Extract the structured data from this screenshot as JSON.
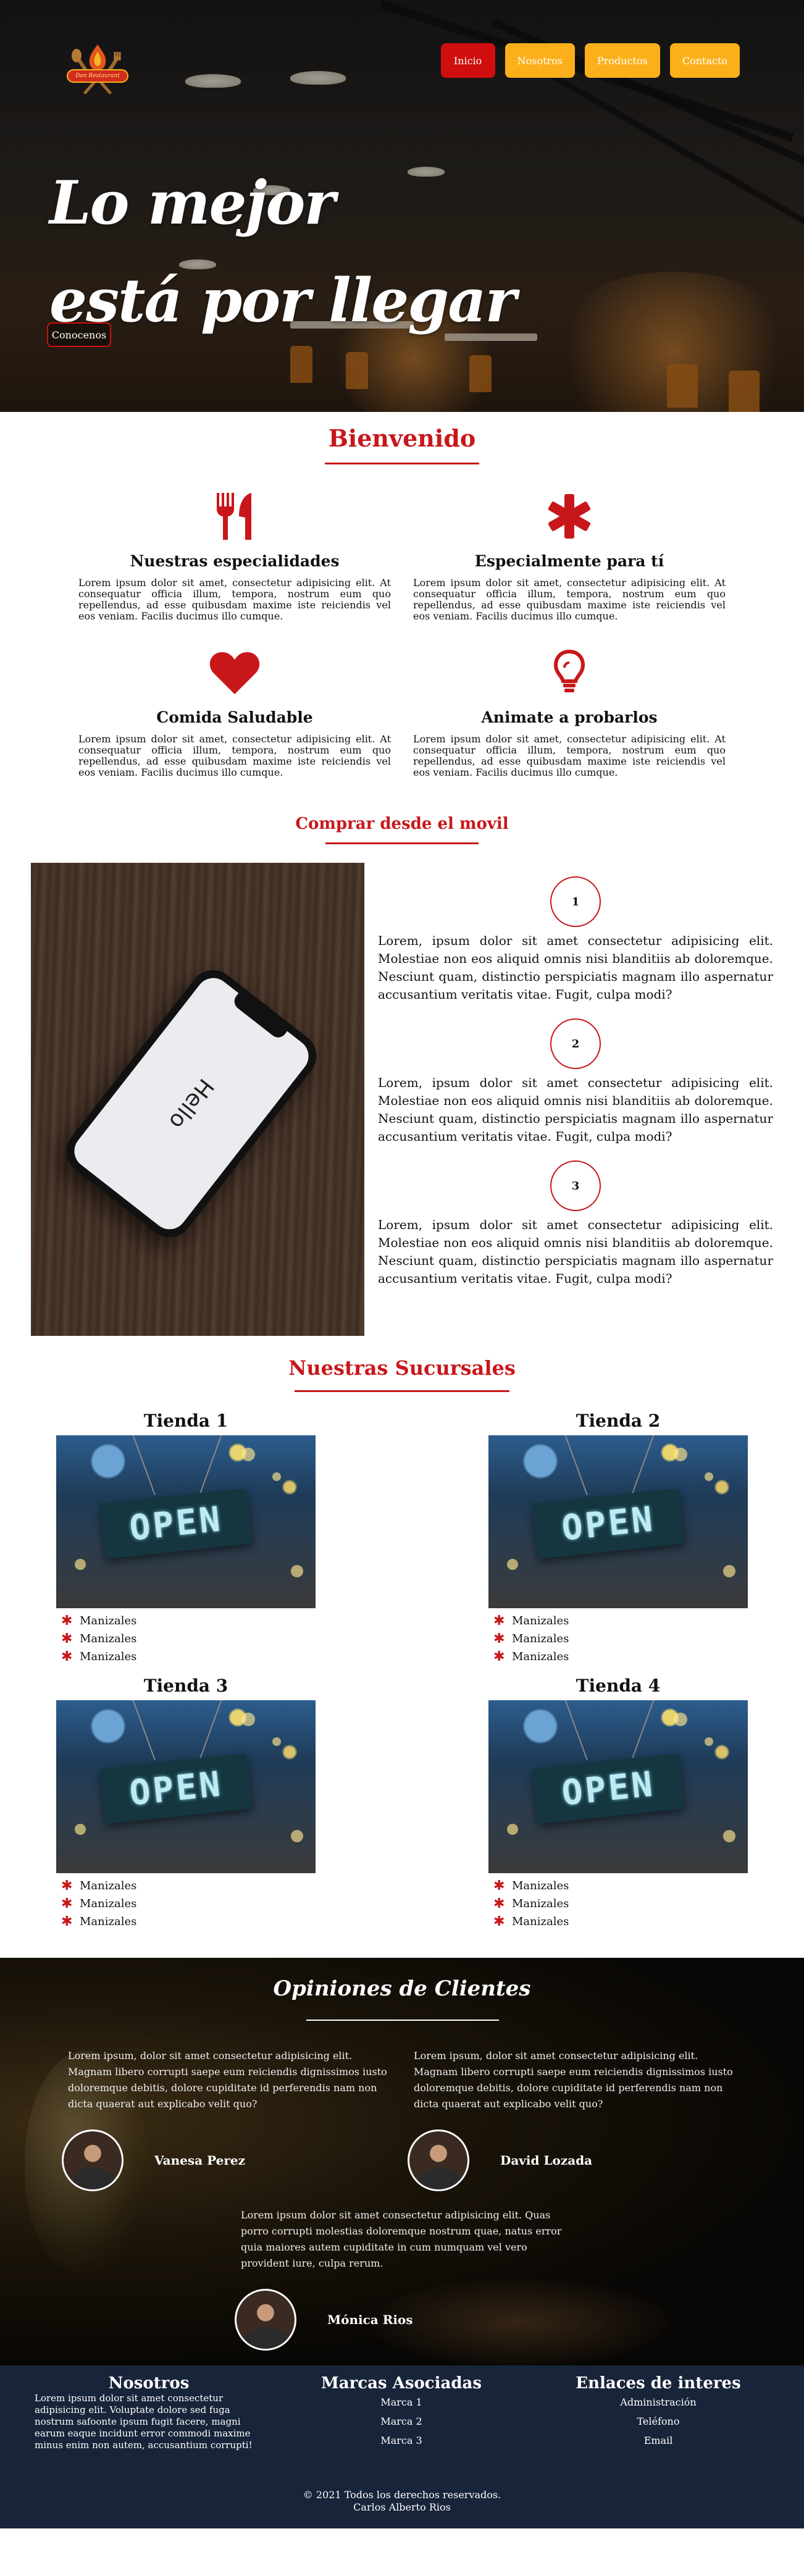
{
  "header": {
    "logo_text": "Don Restaurant",
    "nav": [
      {
        "label": "Inicio",
        "active": true
      },
      {
        "label": "Nosotros",
        "active": false
      },
      {
        "label": "Productos",
        "active": false
      },
      {
        "label": "Contacto",
        "active": false
      }
    ],
    "hero_line1": "Lo mejor",
    "hero_line2": "está por llegar",
    "cta": "Conocenos"
  },
  "welcome": {
    "title": "Bienvenido",
    "features": [
      {
        "icon": "fork-knife-icon",
        "title": "Nuestras especialidades",
        "text": "Lorem ipsum dolor sit amet, consectetur adipisicing elit. At consequatur officia illum, tempora, nostrum eum quo repellendus, ad esse quibusdam maxime iste reiciendis vel eos veniam. Facilis ducimus illo cumque."
      },
      {
        "icon": "asterisk-icon",
        "title": "Especialmente para tí",
        "text": "Lorem ipsum dolor sit amet, consectetur adipisicing elit. At consequatur officia illum, tempora, nostrum eum quo repellendus, ad esse quibusdam maxime iste reiciendis vel eos veniam. Facilis ducimus illo cumque."
      },
      {
        "icon": "heart-icon",
        "title": "Comida Saludable",
        "text": "Lorem ipsum dolor sit amet, consectetur adipisicing elit. At consequatur officia illum, tempora, nostrum eum quo repellendus, ad esse quibusdam maxime iste reiciendis vel eos veniam. Facilis ducimus illo cumque."
      },
      {
        "icon": "lightbulb-icon",
        "title": "Animate a probarlos",
        "text": "Lorem ipsum dolor sit amet, consectetur adipisicing elit. At consequatur officia illum, tempora, nostrum eum quo repellendus, ad esse quibusdam maxime iste reiciendis vel eos veniam. Facilis ducimus illo cumque."
      }
    ]
  },
  "mobile": {
    "title": "Comprar desde el movil",
    "phone_text": "Hello",
    "steps": [
      {
        "number": "1",
        "text": "Lorem, ipsum dolor sit amet consectetur adipisicing elit. Molestiae non eos aliquid omnis nisi blanditiis ab doloremque. Nesciunt quam, distinctio perspiciatis magnam illo aspernatur accusantium veritatis vitae. Fugit, culpa modi?"
      },
      {
        "number": "2",
        "text": "Lorem, ipsum dolor sit amet consectetur adipisicing elit. Molestiae non eos aliquid omnis nisi blanditiis ab doloremque. Nesciunt quam, distinctio perspiciatis magnam illo aspernatur accusantium veritatis vitae. Fugit, culpa modi?"
      },
      {
        "number": "3",
        "text": "Lorem, ipsum dolor sit amet consectetur adipisicing elit. Molestiae non eos aliquid omnis nisi blanditiis ab doloremque. Nesciunt quam, distinctio perspiciatis magnam illo aspernatur accusantium veritatis vitae. Fugit, culpa modi?"
      }
    ]
  },
  "branches": {
    "title": "Nuestras Sucursales",
    "sign_text": "OPEN",
    "stores": [
      {
        "name": "Tienda 1",
        "items": [
          "Manizales",
          "Manizales",
          "Manizales"
        ]
      },
      {
        "name": "Tienda 2",
        "items": [
          "Manizales",
          "Manizales",
          "Manizales"
        ]
      },
      {
        "name": "Tienda 3",
        "items": [
          "Manizales",
          "Manizales",
          "Manizales"
        ]
      },
      {
        "name": "Tienda 4",
        "items": [
          "Manizales",
          "Manizales",
          "Manizales"
        ]
      }
    ]
  },
  "reviews": {
    "title": "Opiniones de Clientes",
    "items": [
      {
        "text": "Lorem ipsum, dolor sit amet consectetur adipisicing elit. Magnam libero corrupti saepe eum reiciendis dignissimos iusto doloremque debitis, dolore cupiditate id perferendis nam non dicta quaerat aut explicabo velit quo?",
        "name": "Vanesa Perez"
      },
      {
        "text": "Lorem ipsum, dolor sit amet consectetur adipisicing elit. Magnam libero corrupti saepe eum reiciendis dignissimos iusto doloremque debitis, dolore cupiditate id perferendis nam non dicta quaerat aut explicabo velit quo?",
        "name": "David Lozada"
      },
      {
        "text": "Lorem ipsum dolor sit amet consectetur adipisicing elit. Quas porro corrupti molestias doloremque nostrum quae, natus error quia maiores autem cupiditate in cum numquam vel vero provident iure, culpa rerum.",
        "name": "Mónica Rios"
      }
    ]
  },
  "footer": {
    "about_title": "Nosotros",
    "about_text": "Lorem ipsum dolor sit amet consectetur adipisicing elit. Voluptate dolore sed fuga nostrum safoonte ipsum fugit facere, magni earum eaque incidunt error commodi maxime minus enim non autem, accusantium corrupti!",
    "brands_title": "Marcas Asociadas",
    "brands": [
      "Marca 1",
      "Marca 2",
      "Marca 3"
    ],
    "links_title": "Enlaces de interes",
    "links": [
      "Administración",
      "Teléfono",
      "Email"
    ],
    "copy_line1": "© 2021 Todos los derechos reservados.",
    "copy_line2": "Carlos Alberto Rios"
  },
  "colors": {
    "accent_red": "#c8171a",
    "nav_yellow": "#fbb01b",
    "footer_navy": "#18243a"
  }
}
